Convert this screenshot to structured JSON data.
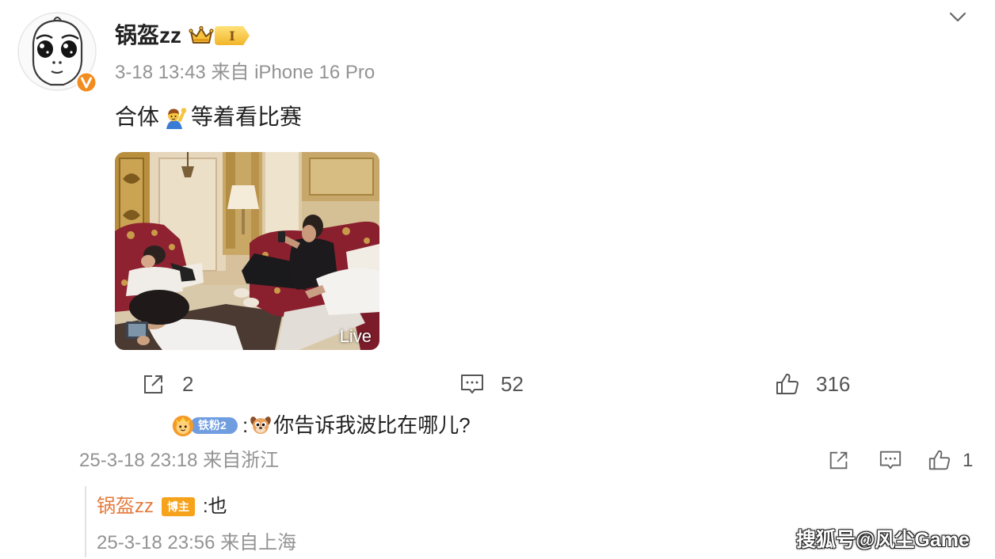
{
  "post": {
    "author": {
      "name": "锅盔zz",
      "vip_badge": "I",
      "avatar_icon": "cartoon-face-avatar",
      "verified_icon": "verified-v-icon"
    },
    "time": "3-18 13:43",
    "source": "来自 iPhone 16 Pro",
    "content": {
      "text_before_emoji": "合体",
      "emoji_icon": "raising-hand-emoji",
      "text_after_emoji": "等着看比赛"
    },
    "photo": {
      "live_label": "Live"
    },
    "actions": {
      "share_count": "2",
      "comment_count": "52",
      "like_count": "316"
    }
  },
  "comment": {
    "fan_badge": "铁粉2",
    "separator": ":",
    "emoji_icon": "dog-face-emoji",
    "text": "你告诉我波比在哪儿?",
    "time": "25-3-18 23:18",
    "source": "来自浙江",
    "like_count": "1"
  },
  "reply": {
    "author": "锅盔zz",
    "author_badge": "博主",
    "text": ":也",
    "time": "25-3-18 23:56",
    "source": "来自上海"
  },
  "watermark": "搜狐号@风尘Game",
  "icons": {
    "share": "share-icon",
    "comment": "comment-icon",
    "like": "thumbs-up-icon",
    "menu": "chevron-down-icon",
    "crown": "crown-icon"
  },
  "colors": {
    "accent_orange": "#f28c1e",
    "reply_name": "#e57a3c",
    "meta_gray": "#939393",
    "fan_badge_blue": "#6f9de0",
    "blogger_badge": "#f7a21b",
    "text": "#333333"
  }
}
